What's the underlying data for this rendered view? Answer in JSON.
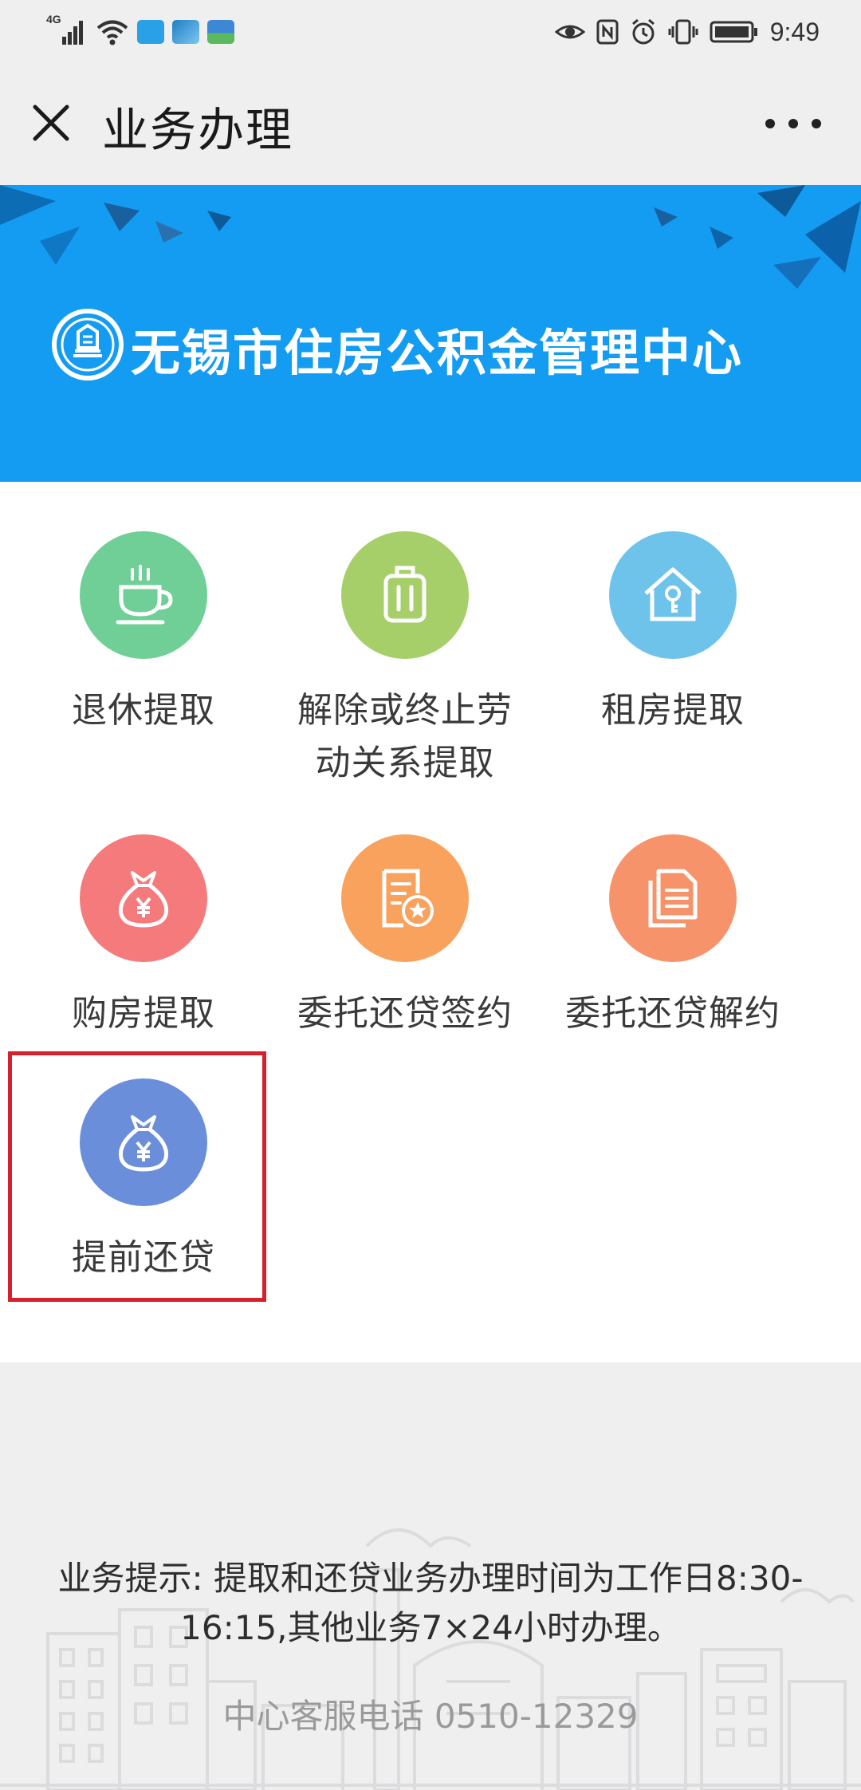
{
  "status_bar": {
    "network": "4G",
    "time": "9:49"
  },
  "nav": {
    "title": "业务办理"
  },
  "banner": {
    "title": "无锡市住房公积金管理中心"
  },
  "services": [
    {
      "label": "退休提取",
      "icon": "coffee-cup-icon",
      "color": "#6fcf97"
    },
    {
      "label": "解除或终止劳动关系提取",
      "icon": "suitcase-icon",
      "color": "#a6cf6a"
    },
    {
      "label": "租房提取",
      "icon": "house-key-icon",
      "color": "#6ec3ea"
    },
    {
      "label": "购房提取",
      "icon": "money-bag-icon",
      "color": "#f47a7c"
    },
    {
      "label": "委托还贷签约",
      "icon": "document-star-icon",
      "color": "#f9a25d"
    },
    {
      "label": "委托还贷解约",
      "icon": "documents-icon",
      "color": "#f7936a"
    },
    {
      "label": "提前还贷",
      "icon": "money-bag-icon",
      "color": "#6a8ed9"
    }
  ],
  "highlight_color": "#d4212b",
  "footer": {
    "tip": "业务提示: 提取和还贷业务办理时间为工作日8:30-16:15,其他业务7×24小时办理。",
    "hotline": "中心客服电话 0510-12329"
  }
}
